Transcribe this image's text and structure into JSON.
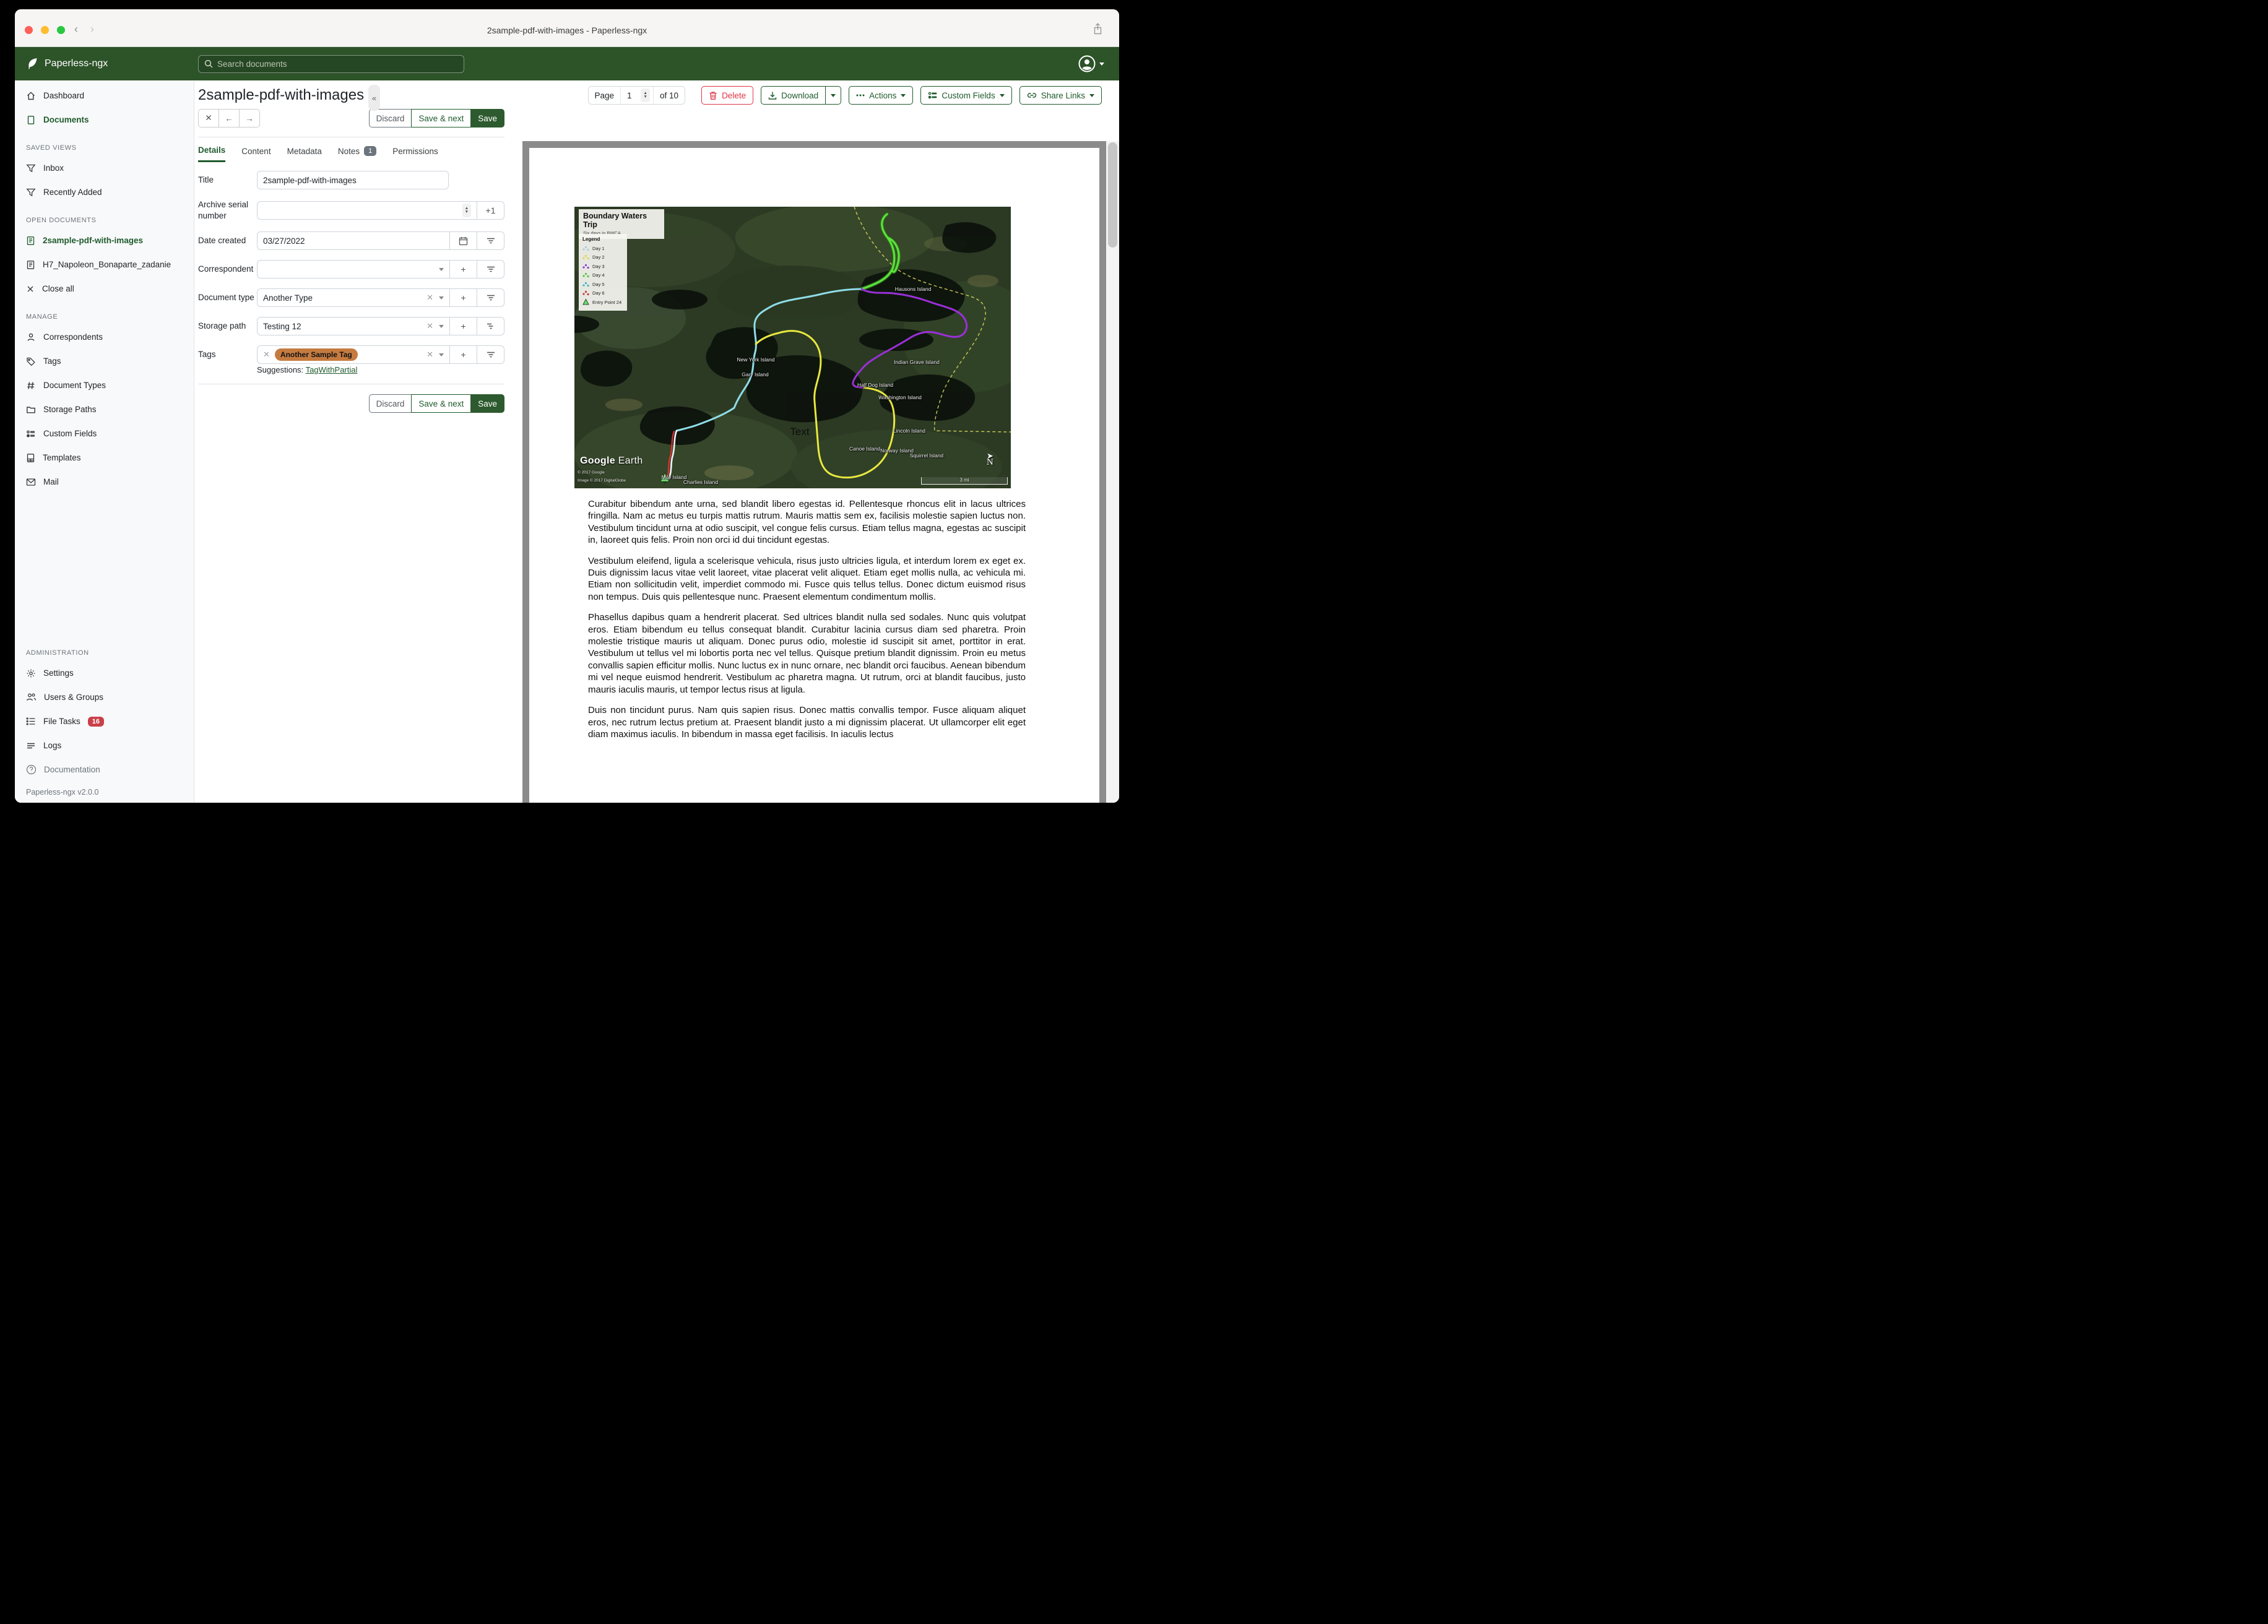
{
  "window": {
    "title": "2sample-pdf-with-images - Paperless-ngx"
  },
  "header": {
    "brand": "Paperless-ngx",
    "search_placeholder": "Search documents"
  },
  "sidebar": {
    "dashboard": "Dashboard",
    "documents": "Documents",
    "saved_views_header": "SAVED VIEWS",
    "inbox": "Inbox",
    "recently_added": "Recently Added",
    "open_documents_header": "OPEN DOCUMENTS",
    "open_doc_1": "2sample-pdf-with-images",
    "open_doc_2": "H7_Napoleon_Bonaparte_zadanie",
    "close_all": "Close all",
    "manage_header": "MANAGE",
    "correspondents": "Correspondents",
    "tags": "Tags",
    "document_types": "Document Types",
    "storage_paths": "Storage Paths",
    "custom_fields": "Custom Fields",
    "templates": "Templates",
    "mail": "Mail",
    "administration_header": "ADMINISTRATION",
    "settings": "Settings",
    "users_groups": "Users & Groups",
    "file_tasks": "File Tasks",
    "file_tasks_badge": "16",
    "logs": "Logs",
    "documentation": "Documentation",
    "version": "Paperless-ngx v2.0.0"
  },
  "toolbar": {
    "page_label": "Page",
    "page_value": "1",
    "page_total": "of 10",
    "delete": "Delete",
    "download": "Download",
    "actions": "Actions",
    "custom_fields": "Custom Fields",
    "share_links": "Share Links"
  },
  "editor": {
    "doc_title": "2sample-pdf-with-images",
    "discard": "Discard",
    "save_next": "Save & next",
    "save": "Save",
    "tabs": {
      "details": "Details",
      "content": "Content",
      "metadata": "Metadata",
      "notes": "Notes",
      "notes_badge": "1",
      "permissions": "Permissions"
    },
    "title_label": "Title",
    "title_value": "2sample-pdf-with-images",
    "asn_label": "Archive serial number",
    "asn_value": "",
    "asn_plus_one": "+1",
    "date_created_label": "Date created",
    "date_created_value": "03/27/2022",
    "correspondent_label": "Correspondent",
    "correspondent_value": "",
    "document_type_label": "Document type",
    "document_type_value": "Another Type",
    "storage_path_label": "Storage path",
    "storage_path_value": "Testing 12",
    "tags_label": "Tags",
    "tag_value": "Another Sample Tag",
    "tag_color": "#c57b40",
    "suggestions_label": "Suggestions:",
    "suggestion_link": "TagWithPartial"
  },
  "preview": {
    "map": {
      "title": "Boundary Waters Trip",
      "subtitle": "Six days in BWCA",
      "legend_title": "Legend",
      "legend": [
        {
          "label": "Day 1",
          "color": "#a9cede"
        },
        {
          "label": "Day 2",
          "color": "#d8d84a"
        },
        {
          "label": "Day 3",
          "color": "#8a3fd4"
        },
        {
          "label": "Day 4",
          "color": "#58c43a"
        },
        {
          "label": "Day 5",
          "color": "#3ab8c4"
        },
        {
          "label": "Day 6",
          "color": "#c43a3a"
        },
        {
          "label": "Entry Point 24",
          "color": "#6fe06f"
        }
      ],
      "labels": {
        "hausons": "Hausons Island",
        "new_york": "New York Island",
        "gary": "Gary Island",
        "indian_grave": "Indian Grave Island",
        "half_dog": "Half Dog Island",
        "washington": "Washington Island",
        "lincoln": "Lincoln Island",
        "canoe": "Canoe Island",
        "norway": "Norway Island",
        "squirrel": "Squirrel Island",
        "mile": "Mile Island",
        "charlies": "Charlies Island",
        "text_note": "Text"
      },
      "credit_logo": "Google Earth",
      "credit_1": "© 2017 Google",
      "credit_2": "Image © 2017 DigitalGlobe",
      "compass": "N",
      "scale": "3 mi"
    },
    "paragraphs": [
      "Curabitur bibendum ante urna, sed blandit libero egestas id. Pellentesque rhoncus elit in lacus ultrices fringilla. Nam ac metus eu turpis mattis rutrum. Mauris mattis sem ex, facilisis molestie sapien luctus non. Vestibulum tincidunt urna at odio suscipit, vel congue felis cursus. Etiam tellus magna, egestas ac suscipit in, laoreet quis felis. Proin non orci id dui tincidunt egestas.",
      "Vestibulum eleifend, ligula a scelerisque vehicula, risus justo ultricies ligula, et interdum lorem ex eget ex. Duis dignissim lacus vitae velit laoreet, vitae placerat velit aliquet. Etiam eget mollis nulla, ac vehicula mi. Etiam non sollicitudin velit, imperdiet commodo mi. Fusce quis tellus tellus. Donec dictum euismod risus non tempus. Duis quis pellentesque nunc. Praesent elementum condimentum mollis.",
      "Phasellus dapibus quam a hendrerit placerat. Sed ultrices blandit nulla sed sodales. Nunc quis volutpat eros. Etiam bibendum eu tellus consequat blandit. Curabitur lacinia cursus diam sed pharetra. Proin molestie tristique mauris ut aliquam. Donec purus odio, molestie id suscipit sit amet, porttitor in erat. Vestibulum ut tellus vel mi lobortis porta nec vel tellus. Quisque pretium blandit dignissim. Proin eu metus convallis sapien efficitur mollis. Nunc luctus ex in nunc ornare, nec blandit orci faucibus. Aenean bibendum mi vel neque euismod hendrerit. Vestibulum ac pharetra magna. Ut rutrum, orci at blandit faucibus, justo mauris iaculis mauris, ut tempor lectus risus at ligula.",
      "Duis non tincidunt purus. Nam quis sapien risus. Donec mattis convallis tempor. Fusce aliquam aliquet eros, nec rutrum lectus pretium at. Praesent blandit justo a mi dignissim placerat. Ut ullamcorper elit eget diam maximus iaculis. In bibendum in massa eget facilisis. In iaculis lectus"
    ]
  }
}
